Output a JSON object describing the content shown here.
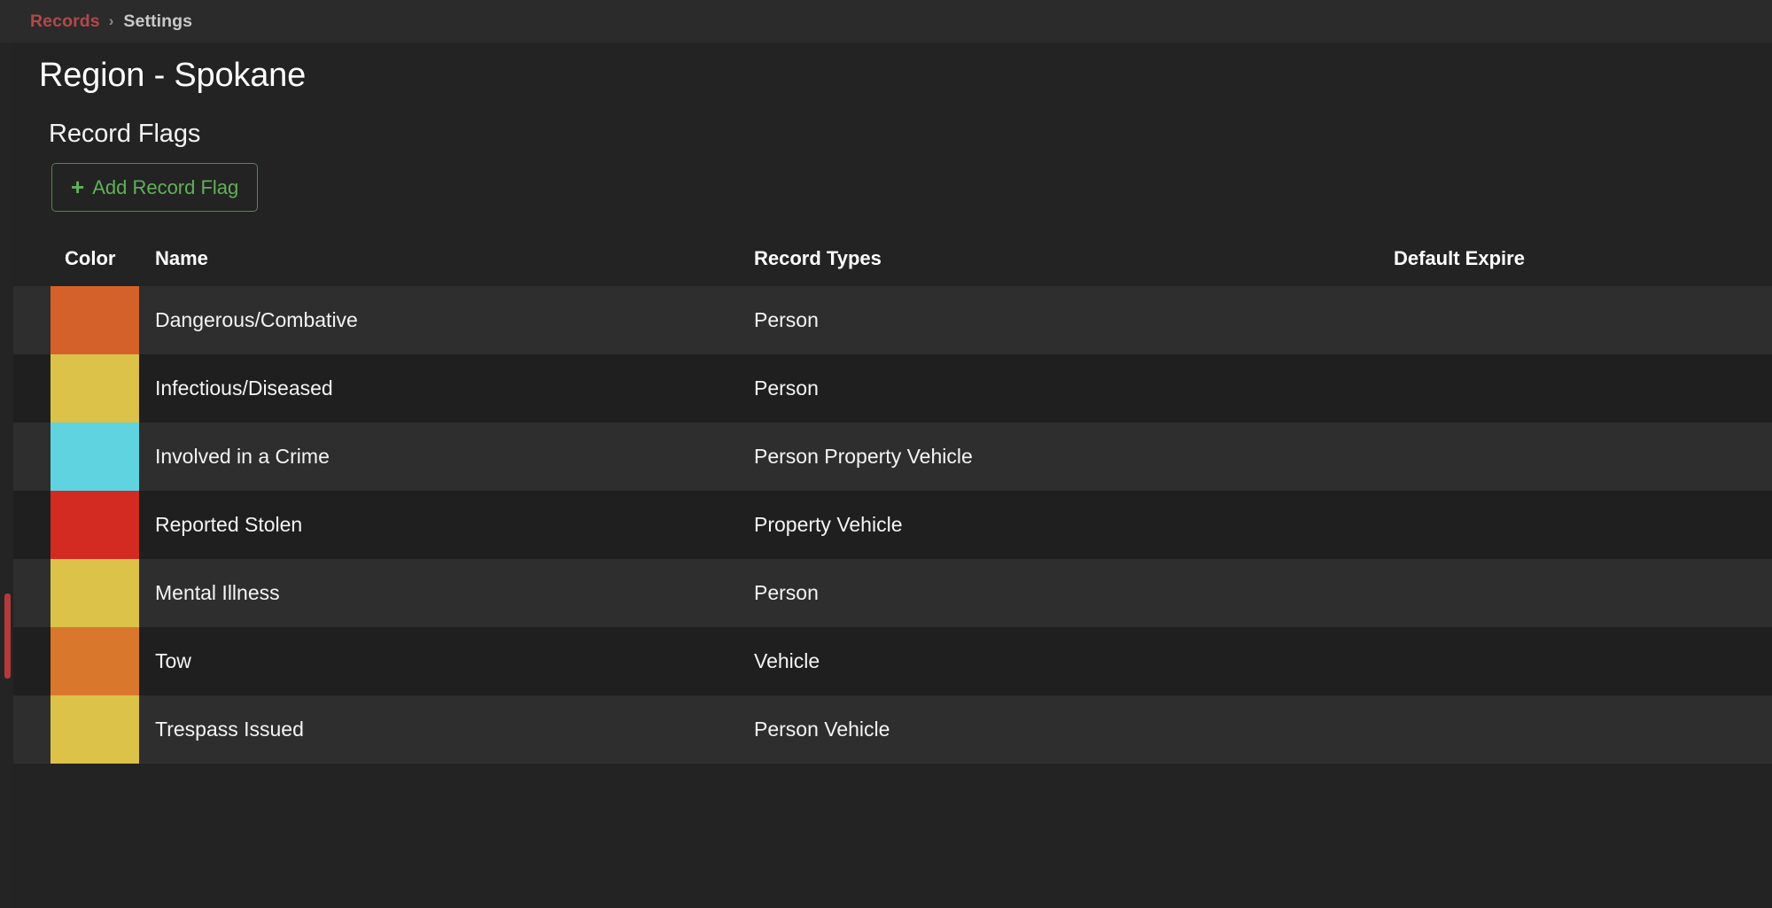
{
  "breadcrumb": {
    "root_label": "Records",
    "separator": "›",
    "current_label": "Settings"
  },
  "page": {
    "title": "Region - Spokane"
  },
  "section": {
    "title": "Record Flags",
    "add_button_label": "Add Record Flag",
    "add_button_icon": "plus-icon",
    "add_button_color": "#61b158"
  },
  "table": {
    "columns": [
      "Color",
      "Name",
      "Record Types",
      "Default Expire"
    ],
    "rows": [
      {
        "color": "#d4612a",
        "color_name": "orange",
        "name": "Dangerous/Combative",
        "record_types": "Person",
        "default_expire": ""
      },
      {
        "color": "#dcc248",
        "color_name": "yellow",
        "name": "Infectious/Diseased",
        "record_types": "Person",
        "default_expire": ""
      },
      {
        "color": "#5fd3e0",
        "color_name": "cyan",
        "name": "Involved in a Crime",
        "record_types": "Person Property Vehicle",
        "default_expire": ""
      },
      {
        "color": "#d32a22",
        "color_name": "red",
        "name": "Reported Stolen",
        "record_types": "Property Vehicle",
        "default_expire": ""
      },
      {
        "color": "#dcc248",
        "color_name": "yellow",
        "name": "Mental Illness",
        "record_types": "Person",
        "default_expire": ""
      },
      {
        "color": "#d9772c",
        "color_name": "orange",
        "name": "Tow",
        "record_types": "Vehicle",
        "default_expire": ""
      },
      {
        "color": "#dcc248",
        "color_name": "yellow",
        "name": "Trespass Issued",
        "record_types": "Person Vehicle",
        "default_expire": ""
      }
    ]
  },
  "theme": {
    "background": "#1c1c1c",
    "panel": "#232323",
    "topbar": "#2b2b2b",
    "row_odd": "#2e2e2e",
    "row_even": "#1f1f1f",
    "accent_red": "#b3484a",
    "accent_green": "#61b158",
    "scrollbar_thumb": "#b5393a"
  }
}
